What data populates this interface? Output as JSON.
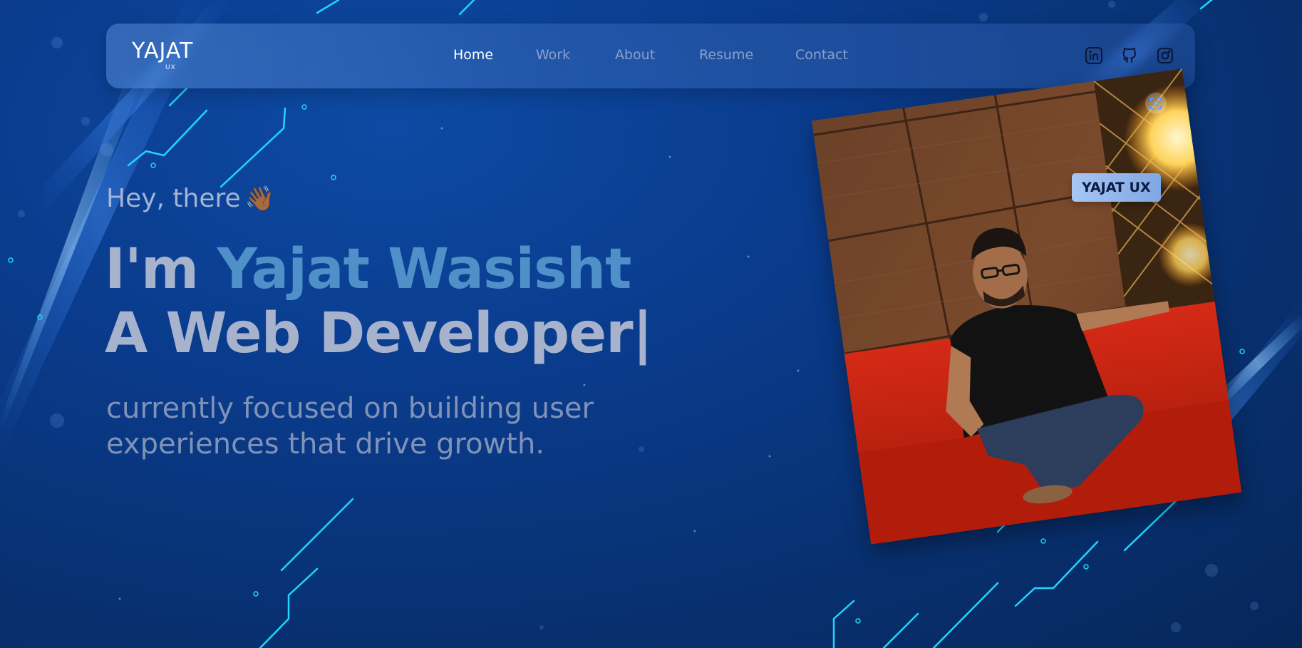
{
  "brand": {
    "logo_text": "YAJAT",
    "logo_sub": "UX"
  },
  "nav": {
    "items": [
      {
        "label": "Home",
        "active": true
      },
      {
        "label": "Work",
        "active": false
      },
      {
        "label": "About",
        "active": false
      },
      {
        "label": "Resume",
        "active": false
      },
      {
        "label": "Contact",
        "active": false
      }
    ]
  },
  "social": [
    {
      "icon": "linkedin-icon"
    },
    {
      "icon": "github-icon"
    },
    {
      "icon": "instagram-icon"
    }
  ],
  "hero": {
    "greeting": "Hey, there",
    "greeting_emoji": "👋🏾",
    "headline_prefix": "I'm ",
    "headline_name": "Yajat Wasisht",
    "headline_role": "A Web Developer|",
    "tagline_line1": "currently focused on building user",
    "tagline_line2": "experiences that drive growth."
  },
  "photo": {
    "badge_label": "YAJAT UX",
    "focus_icon": "focus-icon"
  },
  "colors": {
    "background": "#0a3b8c",
    "accent_name": "#4f90c9",
    "headline": "#a7b3cc",
    "nav_active": "#ffffff",
    "nav_inactive": "#8aa0cc",
    "circuit_cyan": "#1fd6ff"
  }
}
